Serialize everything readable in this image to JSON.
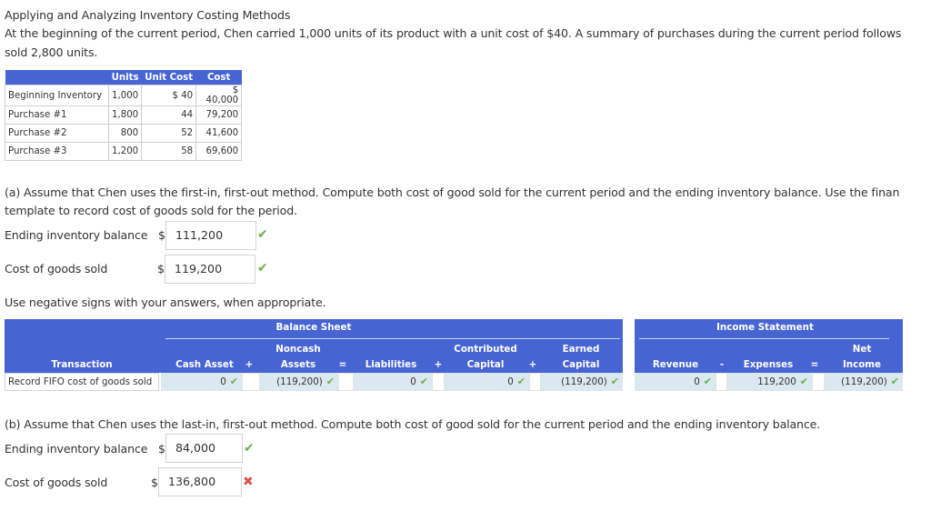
{
  "title": "Applying and Analyzing Inventory Costing Methods",
  "intro_line1": "At the beginning of the current period, Chen carried 1,000 units of its product with a unit cost of $40. A summary of purchases during the current period follows",
  "intro_line2": "sold 2,800 units.",
  "inventory_table": {
    "headers": [
      "",
      "Units",
      "Unit Cost",
      "Cost"
    ],
    "rows": [
      {
        "label": "Beginning Inventory",
        "units": "1,000",
        "unit_cost": "$ 40",
        "cost": "$ 40,000"
      },
      {
        "label": "Purchase #1",
        "units": "1,800",
        "unit_cost": "44",
        "cost": "79,200"
      },
      {
        "label": "Purchase #2",
        "units": "800",
        "unit_cost": "52",
        "cost": "41,600"
      },
      {
        "label": "Purchase #3",
        "units": "1,200",
        "unit_cost": "58",
        "cost": "69,600"
      }
    ]
  },
  "part_a": {
    "prompt_line1": "(a) Assume that Chen uses the first-in, first-out method. Compute both cost of good sold for the current period and the ending inventory balance. Use the finan",
    "prompt_line2": "template to record cost of goods sold for the period.",
    "ending_inventory_label": "Ending inventory balance",
    "ending_inventory_currency": "$",
    "ending_inventory_value": "111,200",
    "ending_inventory_status": "correct",
    "cogs_label": "Cost of goods sold",
    "cogs_currency": "$",
    "cogs_value": "119,200",
    "cogs_status": "correct",
    "negative_note": "Use negative signs with your answers, when appropriate."
  },
  "template": {
    "balance_sheet_title": "Balance Sheet",
    "income_statement_title": "Income Statement",
    "columns": {
      "transaction": "Transaction",
      "cash_asset": "Cash Asset",
      "noncash_assets_1": "Noncash",
      "noncash_assets_2": "Assets",
      "liabilities": "Liabilities",
      "contributed_capital_1": "Contributed",
      "contributed_capital_2": "Capital",
      "earned_capital_1": "Earned",
      "earned_capital_2": "Capital",
      "revenue": "Revenue",
      "expenses": "Expenses",
      "net_income_1": "Net",
      "net_income_2": "Income"
    },
    "operators": {
      "plus": "+",
      "equals": "=",
      "minus": "-"
    },
    "row": {
      "label": "Record FIFO cost of goods sold",
      "cash_asset": "0",
      "noncash_assets": "(119,200)",
      "liabilities": "0",
      "contributed_capital": "0",
      "earned_capital": "(119,200)",
      "revenue": "0",
      "expenses": "119,200",
      "net_income": "(119,200)"
    },
    "check_glyph": "✔"
  },
  "part_b": {
    "prompt": "(b) Assume that Chen uses the last-in, first-out method. Compute both cost of good sold for the current period and the ending inventory balance.",
    "ending_inventory_label": "Ending inventory balance",
    "ending_inventory_currency": "$",
    "ending_inventory_value": "84,000",
    "ending_inventory_status": "correct",
    "cogs_label": "Cost of goods sold",
    "cogs_currency": "$",
    "cogs_value": "136,800",
    "cogs_status": "incorrect"
  },
  "status_glyphs": {
    "correct": "✔",
    "incorrect": "✖"
  },
  "colors": {
    "header_blue": "#4764d3",
    "cell_blue": "#dbe8f0",
    "correct_green": "#6ab04c",
    "incorrect_red": "#d9534f"
  }
}
